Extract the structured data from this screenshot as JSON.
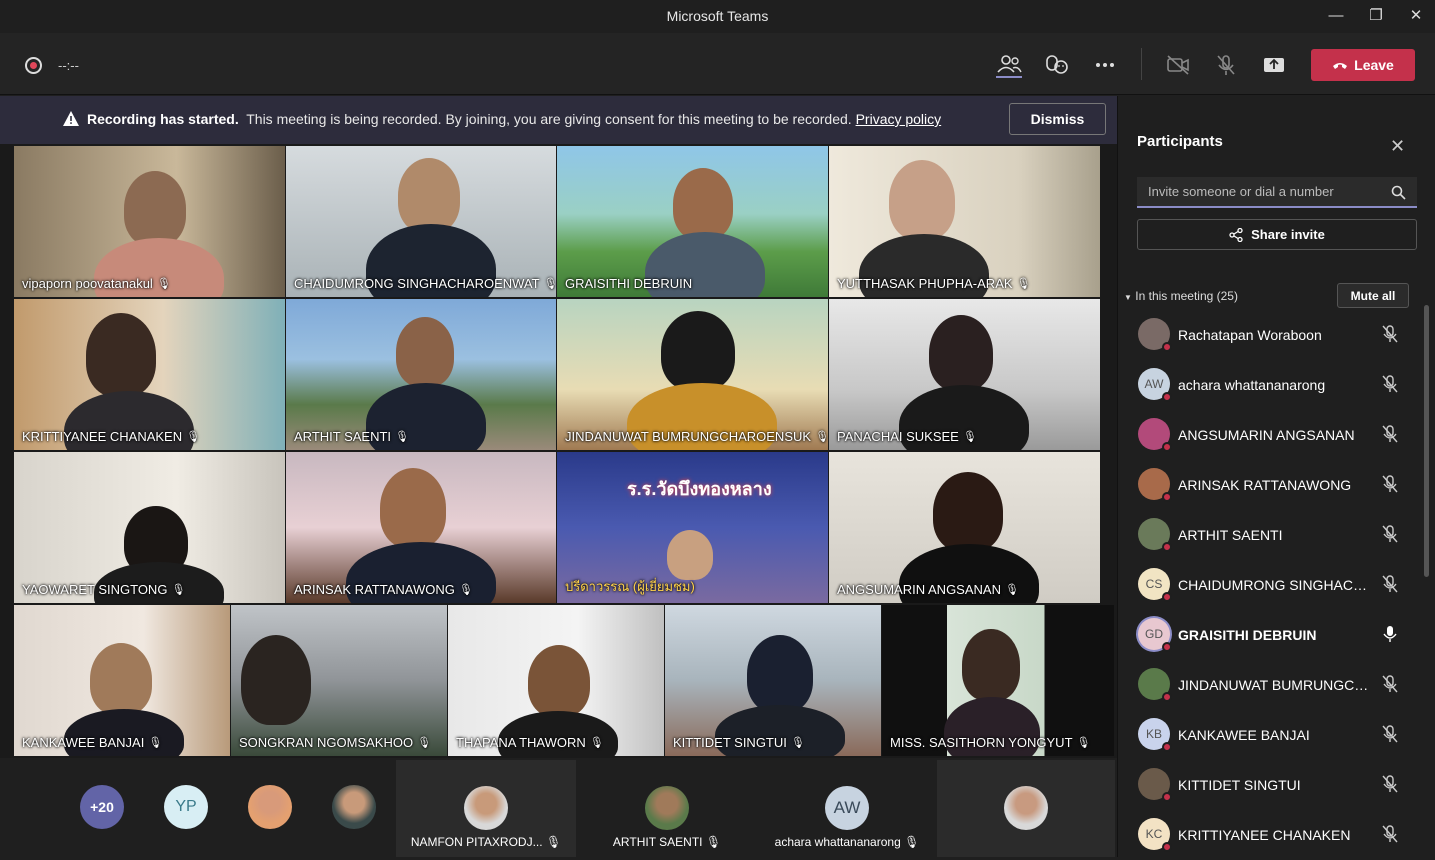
{
  "window": {
    "title": "Microsoft Teams"
  },
  "toolbar": {
    "timer": "--:--",
    "leave_label": "Leave"
  },
  "banner": {
    "bold": "Recording has started.",
    "message": "This meeting is being recorded. By joining, you are giving consent for this meeting to be recorded.",
    "link": "Privacy policy",
    "dismiss_label": "Dismiss"
  },
  "grid": [
    {
      "name": "vipaporn poovatanakul"
    },
    {
      "name": "CHAIDUMRONG SINGHACHAROENWAT"
    },
    {
      "name": "GRAISITHI DEBRUIN"
    },
    {
      "name": "YUTTHASAK PHUPHA-ARAK"
    },
    {
      "name": "KRITTIYANEE CHANAKEN"
    },
    {
      "name": "ARTHIT SAENTI"
    },
    {
      "name": "JINDANUWAT BUMRUNGCHAROENSUK"
    },
    {
      "name": "PANACHAI SUKSEE"
    },
    {
      "name": "YAOWARET SINGTONG"
    },
    {
      "name": "ARINSAK RATTANAWONG"
    },
    {
      "name": "ปรีดาวรรณ (ผู้เยี่ยมชม)"
    },
    {
      "name": "ANGSUMARIN ANGSANAN"
    },
    {
      "name": "KANKAWEE BANJAI"
    },
    {
      "name": "SONGKRAN NGOMSAKHOO"
    },
    {
      "name": "THAPANA THAWORN"
    },
    {
      "name": "KITTIDET SINGTUI"
    },
    {
      "name": "MISS. SASITHORN YONGYUT"
    }
  ],
  "school_sign": "ร.ร.วัดบึงทองหลาง",
  "strip": {
    "overflow_count": "+20",
    "yp_initials": "YP",
    "tiles": [
      {
        "name": "NAMFON PITAXRODJ..."
      },
      {
        "name": "ARTHIT SAENTI"
      },
      {
        "initials": "AW",
        "name": "achara whattananarong"
      }
    ]
  },
  "participants": {
    "title": "Participants",
    "invite_placeholder": "Invite someone or dial a number",
    "share_label": "Share invite",
    "section_label": "In this meeting (25)",
    "mute_all_label": "Mute all",
    "list": [
      {
        "name": "Rachatapan Woraboon",
        "initials": "",
        "avatar_color": "#7a6a66",
        "mic": "muted"
      },
      {
        "name": "achara whattananarong",
        "initials": "AW",
        "avatar_color": "#c7d3e0",
        "mic": "muted"
      },
      {
        "name": "ANGSUMARIN ANGSANAN",
        "initials": "",
        "avatar_color": "#b24a7a",
        "mic": "muted"
      },
      {
        "name": "ARINSAK RATTANAWONG",
        "initials": "",
        "avatar_color": "#a86a4a",
        "mic": "muted"
      },
      {
        "name": "ARTHIT SAENTI",
        "initials": "",
        "avatar_color": "#6a7a5a",
        "mic": "muted"
      },
      {
        "name": "CHAIDUMRONG SINGHACHA...",
        "initials": "CS",
        "avatar_color": "#f1e4c3",
        "mic": "muted"
      },
      {
        "name": "GRAISITHI DEBRUIN",
        "initials": "GD",
        "avatar_color": "#e8c8d0",
        "mic": "on"
      },
      {
        "name": "JINDANUWAT BUMRUNGCH...",
        "initials": "",
        "avatar_color": "#5a7a4a",
        "mic": "muted"
      },
      {
        "name": "KANKAWEE BANJAI",
        "initials": "KB",
        "avatar_color": "#c9d3ec",
        "mic": "muted"
      },
      {
        "name": "KITTIDET SINGTUI",
        "initials": "",
        "avatar_color": "#6a5a4a",
        "mic": "muted"
      },
      {
        "name": "KRITTIYANEE CHANAKEN",
        "initials": "KC",
        "avatar_color": "#f3e2c4",
        "mic": "muted"
      }
    ]
  },
  "colors": {
    "accent": "#8b8cc7",
    "leave": "#c4314b",
    "banner": "#2d2c3c"
  }
}
